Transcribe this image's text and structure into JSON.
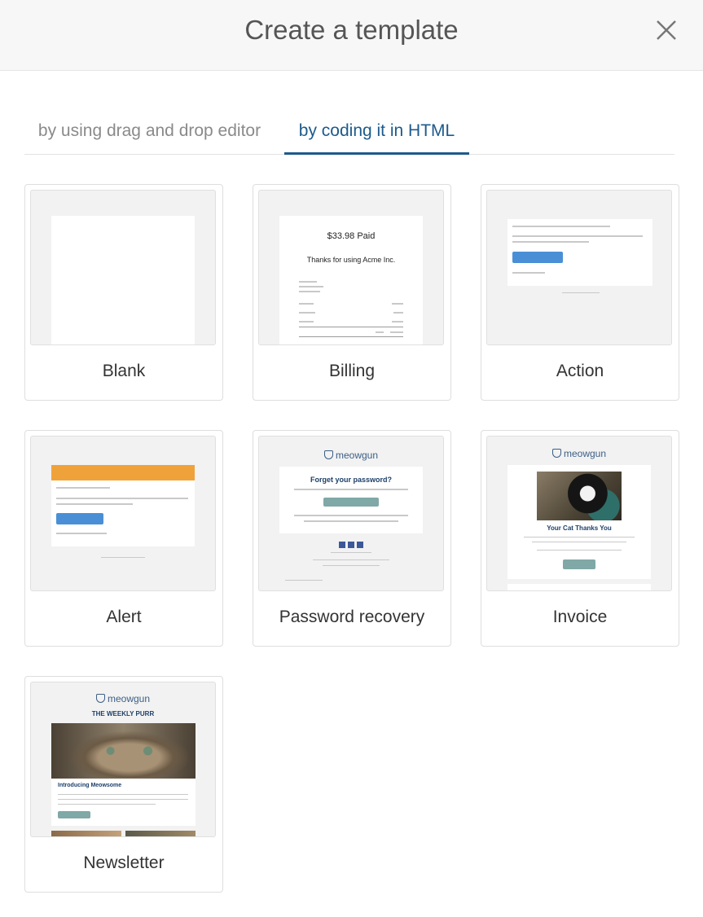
{
  "header": {
    "title": "Create a template"
  },
  "icons": {
    "close": "close-icon",
    "brand": "meowgun-shield-icon"
  },
  "tabs": [
    {
      "label": "by using drag and drop editor",
      "active": false
    },
    {
      "label": "by coding it in HTML",
      "active": true
    }
  ],
  "templates": [
    {
      "name": "Blank"
    },
    {
      "name": "Billing"
    },
    {
      "name": "Action"
    },
    {
      "name": "Alert"
    },
    {
      "name": "Password recovery"
    },
    {
      "name": "Invoice"
    },
    {
      "name": "Newsletter"
    }
  ],
  "previews": {
    "billing": {
      "amount": "$33.98 Paid",
      "thanks": "Thanks for using Acme Inc."
    },
    "password": {
      "brand": "meowgun",
      "heading": "Forget your password?"
    },
    "invoice": {
      "brand": "meowgun",
      "heading": "Your Cat Thanks You"
    },
    "newsletter": {
      "brand": "meowgun",
      "heading": "THE WEEKLY PURR",
      "article_title": "Introducing Meowsome"
    }
  },
  "colors": {
    "accent": "#1d5a8c",
    "alert_bar": "#f0a23a",
    "action_button": "#4a8fd6",
    "brand_button": "#7fa8a6"
  }
}
